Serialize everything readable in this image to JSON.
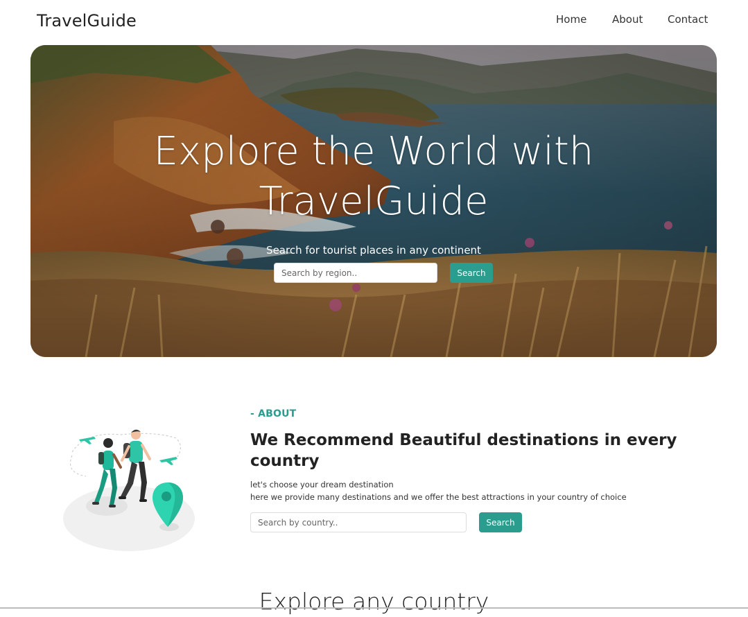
{
  "nav": {
    "brand": "TravelGuide",
    "links": [
      "Home",
      "About",
      "Contact"
    ]
  },
  "hero": {
    "title_line1": "Explore the World with",
    "title_line2": "TravelGuide",
    "subtitle": "Search for tourist places in any continent",
    "search_placeholder": "Search by region..",
    "search_button": "Search"
  },
  "about": {
    "kicker": "- ABOUT",
    "heading_line1": "We Recommend Beautiful destinations in every",
    "heading_line2": "country",
    "line1": "let's choose your dream destination",
    "line2": "here we provide many destinations and we offer the best attractions in your country of choice",
    "search_placeholder": "Search by country..",
    "search_button": "Search"
  },
  "explore": {
    "title": "Explore any country"
  },
  "colors": {
    "accent": "#2a9d8f",
    "text": "#222222"
  },
  "icons": [
    "airplane-icon",
    "location-pin-icon"
  ]
}
